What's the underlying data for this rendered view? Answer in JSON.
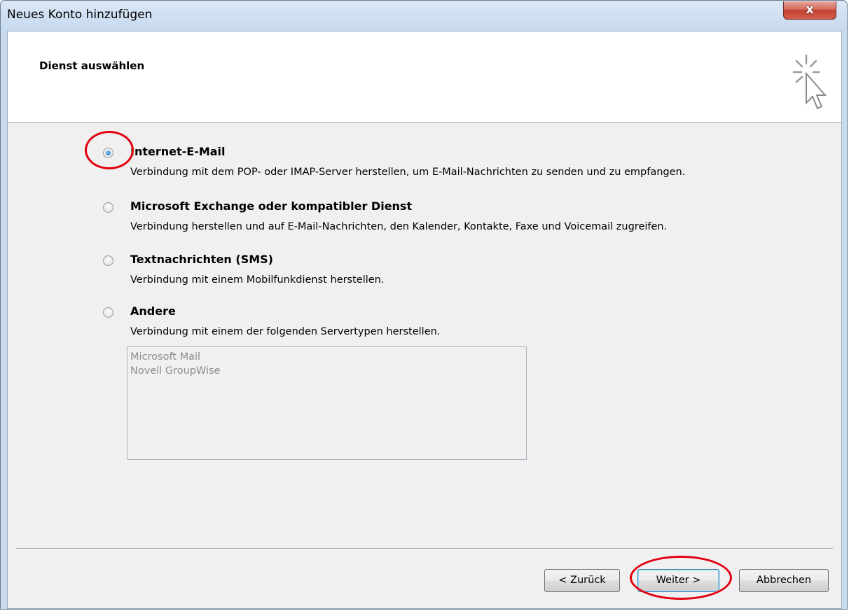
{
  "window": {
    "title": "Neues Konto hinzufügen",
    "close_glyph": "x"
  },
  "header": {
    "title": "Dienst auswählen",
    "icon": "wizard-cursor-icon"
  },
  "options": [
    {
      "label": "Internet-E-Mail",
      "description": "Verbindung mit dem POP- oder IMAP-Server herstellen, um E-Mail-Nachrichten zu senden und zu empfangen.",
      "selected": true
    },
    {
      "label": "Microsoft Exchange oder kompatibler Dienst",
      "description": "Verbindung herstellen und auf E-Mail-Nachrichten, den Kalender, Kontakte, Faxe und Voicemail zugreifen.",
      "selected": false
    },
    {
      "label": "Textnachrichten (SMS)",
      "description": "Verbindung mit einem Mobilfunkdienst herstellen.",
      "selected": false
    },
    {
      "label": "Andere",
      "description": "Verbindung mit einem der folgenden Servertypen herstellen.",
      "selected": false
    }
  ],
  "server_types": [
    "Microsoft Mail",
    "Novell GroupWise"
  ],
  "buttons": {
    "back": "< Zurück",
    "next": "Weiter >",
    "cancel": "Abbrechen"
  },
  "colors": {
    "annotation": "#e3000f",
    "close_button": "#c04131",
    "frame": "#c9dcef"
  }
}
